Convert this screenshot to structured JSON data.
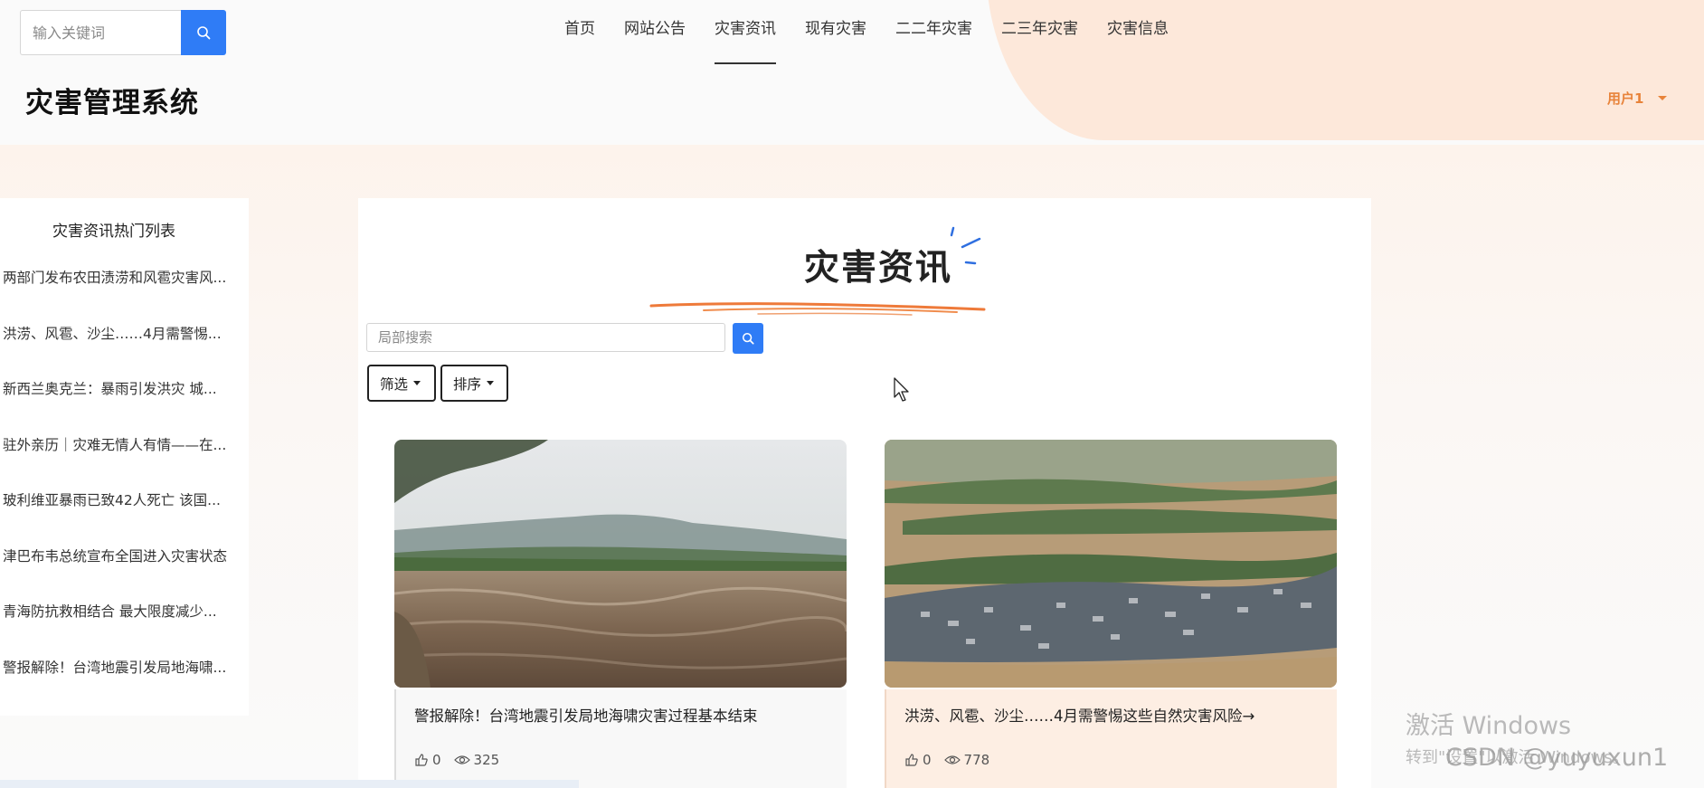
{
  "header": {
    "search": {
      "placeholder": "输入关键词"
    },
    "nav": [
      {
        "label": "首页"
      },
      {
        "label": "网站公告"
      },
      {
        "label": "灾害资讯"
      },
      {
        "label": "现有灾害"
      },
      {
        "label": "二二年灾害"
      },
      {
        "label": "二三年灾害"
      },
      {
        "label": "灾害信息"
      }
    ],
    "active_nav": "灾害资讯",
    "site_title": "灾害管理系统",
    "user": "用户1"
  },
  "hot_list": {
    "title": "灾害资讯热门列表",
    "items": [
      "两部门发布农田渍涝和风雹灾害风...",
      "洪涝、风雹、沙尘……4月需警惕...",
      "新西兰奥克兰：暴雨引发洪灾 城...",
      "驻外亲历｜灾难无情人有情——在...",
      "玻利维亚暴雨已致42人死亡 该国...",
      "津巴布韦总统宣布全国进入灾害状态",
      "青海防抗救相结合 最大限度减少...",
      "警报解除！台湾地震引发局地海啸..."
    ]
  },
  "main": {
    "title": "灾害资讯",
    "search": {
      "placeholder": "局部搜索"
    },
    "filter_label": "筛选",
    "sort_label": "排序",
    "cards": [
      {
        "title": "警报解除！台湾地震引发局地海啸灾害过程基本结束",
        "likes": "0",
        "views": "325",
        "image": "flood-river-photo"
      },
      {
        "title": "洪涝、风雹、沙尘……4月需警惕这些自然灾害风险→",
        "likes": "0",
        "views": "778",
        "image": "flooded-village-aerial-photo"
      }
    ]
  },
  "watermark": {
    "windows_line1": "激活 Windows",
    "windows_line2": "转到\"设置\"以激活 Windows。",
    "csdn": "CSDN @yuyuxun1"
  },
  "colors": {
    "accent_blue": "#2f7cf6",
    "user_orange": "#e8833a",
    "header_blob": "#fde8da"
  },
  "icons": [
    "search-icon",
    "like-icon",
    "eye-icon",
    "caret-down-icon",
    "mouse-cursor-icon"
  ]
}
